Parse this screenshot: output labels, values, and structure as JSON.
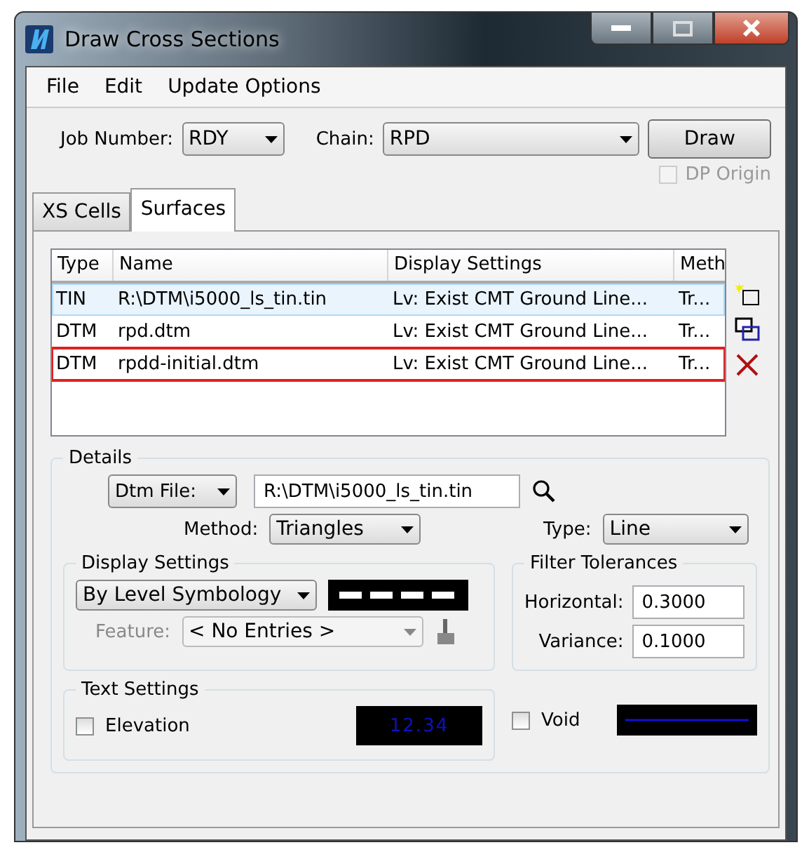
{
  "window": {
    "title": "Draw Cross Sections"
  },
  "menu": [
    "File",
    "Edit",
    "Update Options"
  ],
  "job_number": {
    "label": "Job Number:",
    "value": "RDY"
  },
  "chain": {
    "label": "Chain:",
    "value": "RPD"
  },
  "draw_button": "Draw",
  "dp_origin": {
    "label": "DP Origin",
    "checked": false,
    "disabled": true
  },
  "tabs": [
    {
      "label": "XS Cells",
      "selected": false
    },
    {
      "label": "Surfaces",
      "selected": true
    }
  ],
  "table": {
    "columns": [
      "Type",
      "Name",
      "Display Settings",
      "Meth"
    ],
    "rows": [
      {
        "cells": [
          "TIN",
          "R:\\DTM\\i5000_ls_tin.tin",
          "Lv: Exist CMT Ground Line...",
          "Tr..."
        ],
        "selected": true,
        "highlighted": false
      },
      {
        "cells": [
          "DTM",
          "rpd.dtm",
          "Lv: Exist CMT Ground Line...",
          "Tr..."
        ],
        "selected": false,
        "highlighted": false
      },
      {
        "cells": [
          "DTM",
          "rpdd-initial.dtm",
          "Lv: Exist CMT Ground Line...",
          "Tr..."
        ],
        "selected": false,
        "highlighted": true
      }
    ]
  },
  "details": {
    "title": "Details",
    "file_type": "Dtm File:",
    "file_path": "R:\\DTM\\i5000_ls_tin.tin",
    "method_label": "Method:",
    "method": "Triangles",
    "type_label": "Type:",
    "type": "Line"
  },
  "display_settings": {
    "title": "Display Settings",
    "mode": "By Level Symbology",
    "feature_label": "Feature:",
    "feature": "< No Entries >",
    "feature_disabled": true
  },
  "filter_tolerances": {
    "title": "Filter Tolerances",
    "fields": [
      {
        "label": "Horizontal:",
        "value": "0.3000"
      },
      {
        "label": "Variance:",
        "value": "0.1000"
      }
    ]
  },
  "text_settings": {
    "title": "Text Settings",
    "elevation": {
      "label": "Elevation",
      "checked": false
    },
    "preview": "12.34"
  },
  "void": {
    "label": "Void",
    "checked": false
  }
}
